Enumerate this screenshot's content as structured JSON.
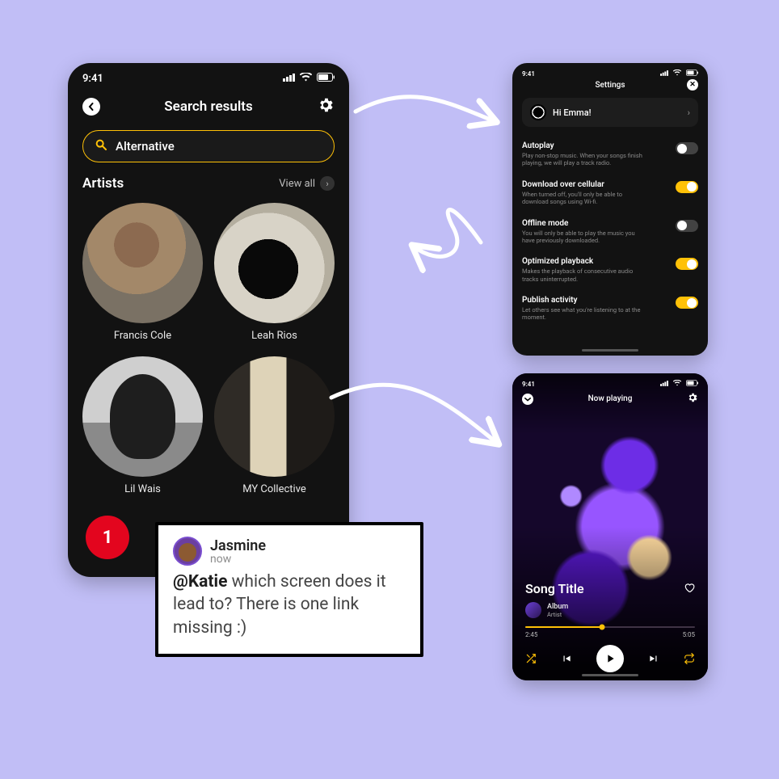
{
  "status_time": "9:41",
  "screenA": {
    "title": "Search results",
    "search_value": "Alternative",
    "section_header": "Artists",
    "view_all": "View all",
    "artists": [
      {
        "name": "Francis Cole"
      },
      {
        "name": "Leah Rios"
      },
      {
        "name": "Lil Wais"
      },
      {
        "name": "MY Collective"
      }
    ],
    "badge_count": "1"
  },
  "screenB": {
    "title": "Settings",
    "greeting": "Hi Emma!",
    "rows": [
      {
        "title": "Autoplay",
        "desc": "Play non-stop music. When your songs finish playing, we will play a track radio.",
        "on": false
      },
      {
        "title": "Download over cellular",
        "desc": "When turned off, you'll only be able to download songs using Wi-fi.",
        "on": true
      },
      {
        "title": "Offline mode",
        "desc": "You will only be able to play the music you have previously downloaded.",
        "on": false
      },
      {
        "title": "Optimized playback",
        "desc": "Makes the playback of consecutive audio tracks uninterrupted.",
        "on": true
      },
      {
        "title": "Publish activity",
        "desc": "Let others see what you're listening to at the moment.",
        "on": true
      }
    ]
  },
  "screenC": {
    "title": "Now playing",
    "song": "Song Title",
    "album": "Album",
    "artist": "Artist",
    "elapsed": "2:45",
    "total": "5:05"
  },
  "comment": {
    "author": "Jasmine",
    "time": "now",
    "mention": "@Katie",
    "rest": " which screen does it lead to? There is one link missing :)"
  }
}
